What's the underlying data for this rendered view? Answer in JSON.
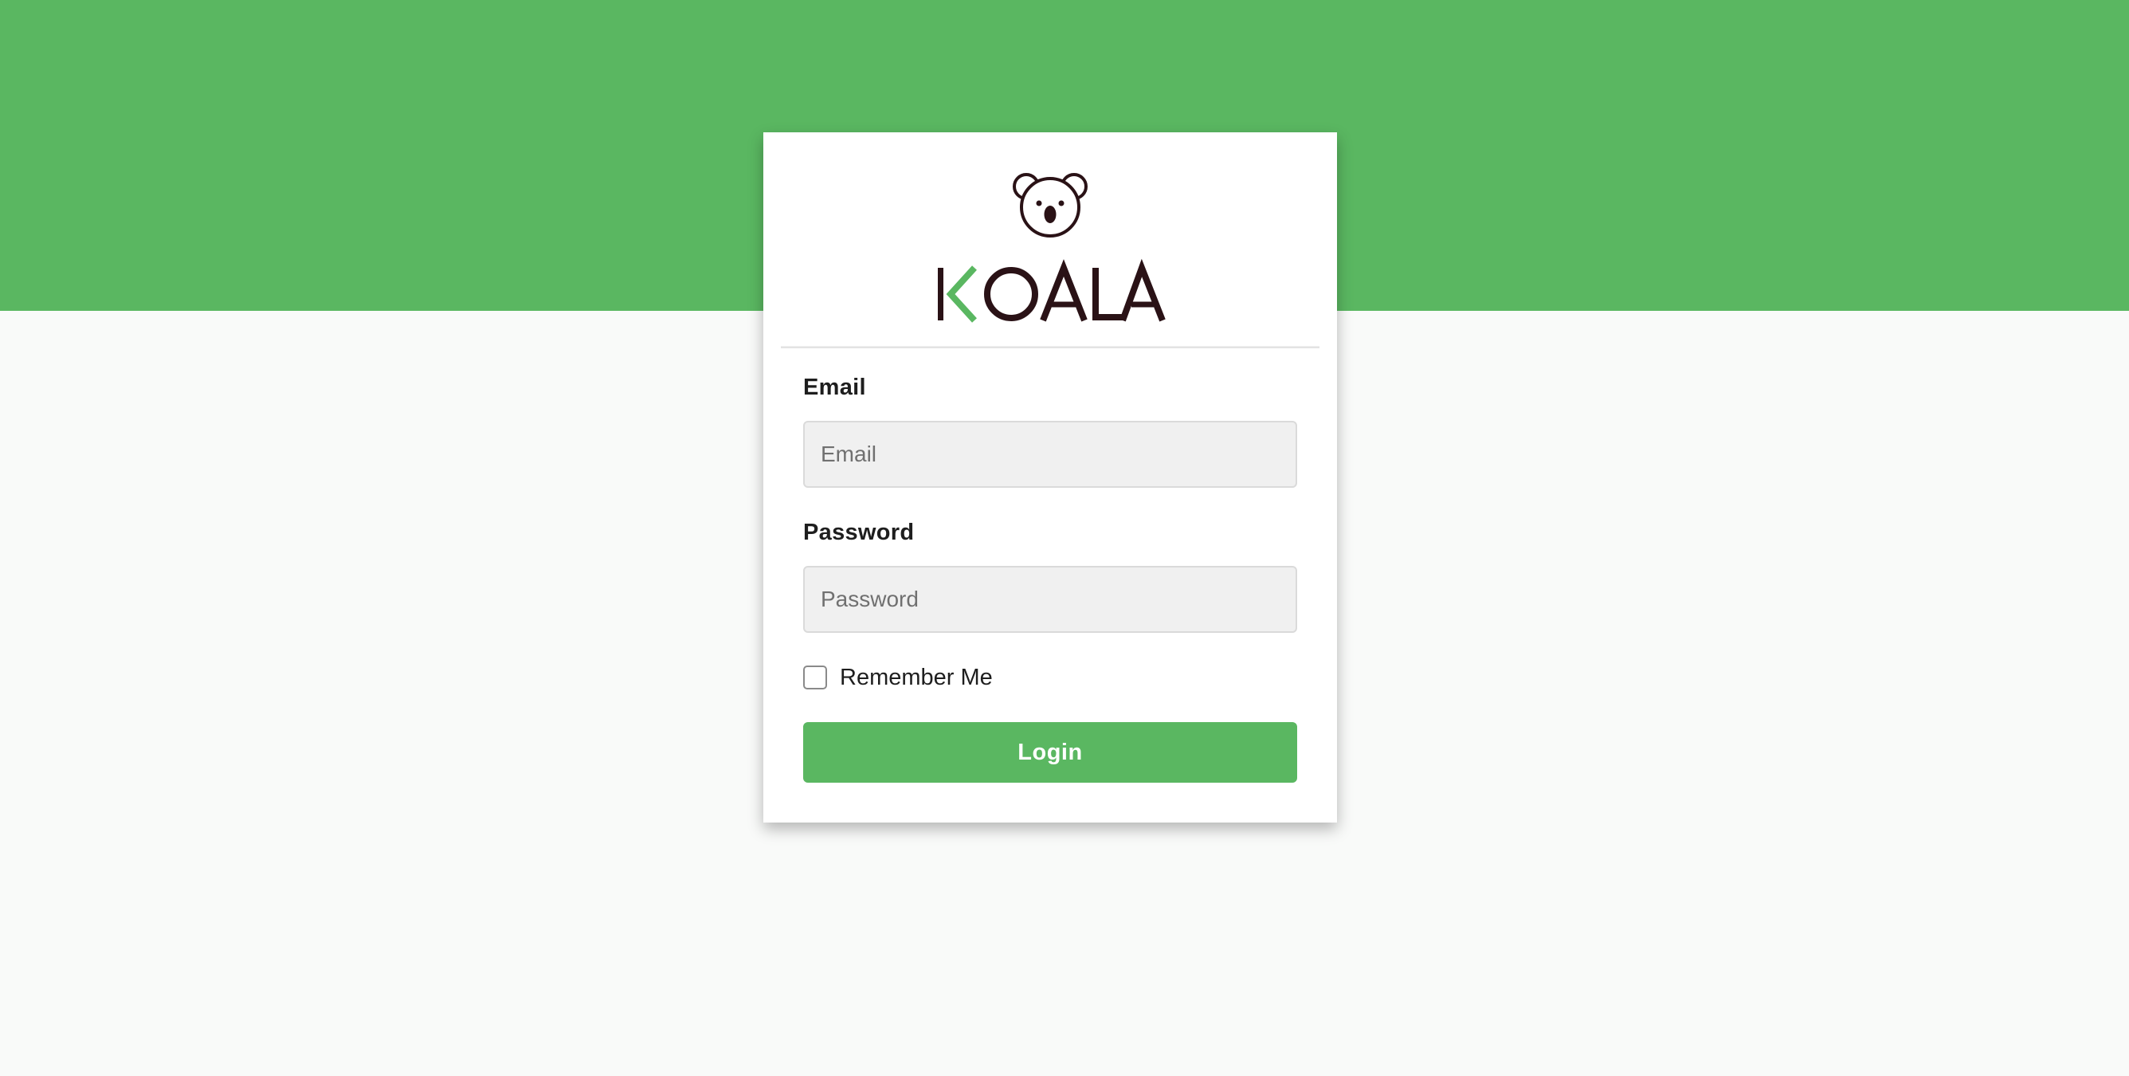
{
  "brand": {
    "name": "KOALA",
    "icon": "koala-icon",
    "colors": {
      "primary": "#5ab761",
      "dark": "#2a1216",
      "background": "#f9faf9"
    }
  },
  "login_form": {
    "email_label": "Email",
    "email_placeholder": "Email",
    "email_value": "",
    "password_label": "Password",
    "password_placeholder": "Password",
    "password_value": "",
    "remember_label": "Remember Me",
    "remember_checked": false,
    "submit_label": "Login"
  }
}
